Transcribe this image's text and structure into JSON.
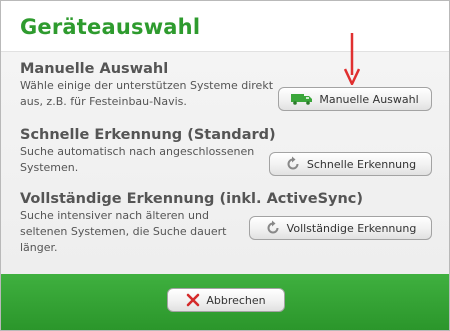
{
  "dialog": {
    "title": "Geräteauswahl"
  },
  "sections": [
    {
      "title": "Manuelle Auswahl",
      "description_lines": [
        "Wähle einige der unterstützen Systeme direkt",
        "aus, z.B. für Festeinbau-Navis."
      ],
      "button_label": "Manuelle Auswahl",
      "button_icon": "truck-icon"
    },
    {
      "title": "Schnelle Erkennung (Standard)",
      "description_lines": [
        "Suche automatisch nach angeschlossenen",
        "Systemen."
      ],
      "button_label": "Schnelle Erkennung",
      "button_icon": "refresh-icon"
    },
    {
      "title": "Vollständige Erkennung (inkl. ActiveSync)",
      "description_lines": [
        "Suche intensiver nach älteren und",
        "seltenen Systemen, die Suche dauert",
        "länger."
      ],
      "button_label": "Vollständige Erkennung",
      "button_icon": "refresh-icon"
    }
  ],
  "footer": {
    "cancel_label": "Abbrechen",
    "cancel_icon": "close-icon"
  },
  "colors": {
    "title_green": "#2e9b2e",
    "footer_green": "#33a233",
    "arrow_red": "#e03030",
    "text_gray": "#555555"
  }
}
